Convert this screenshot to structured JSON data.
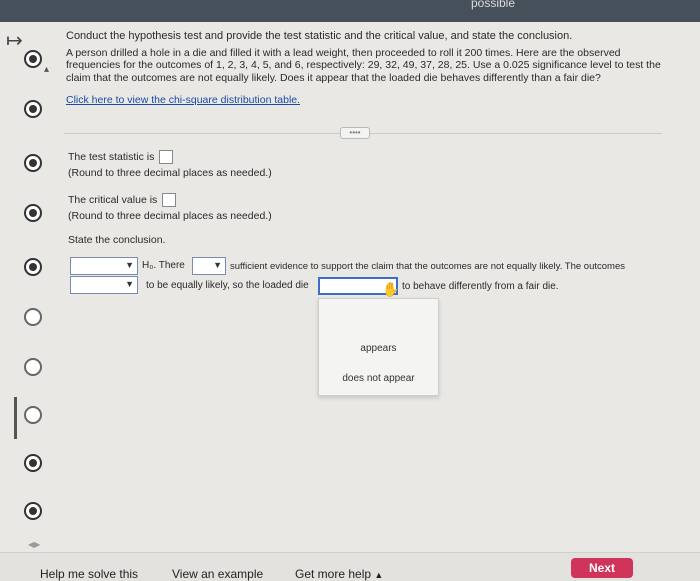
{
  "header": {
    "status_text": "possible"
  },
  "question": {
    "instruction": "Conduct the hypothesis test and provide the test statistic and the critical value, and state the conclusion.",
    "body": "A person drilled a hole in a die and filled it with a lead weight, then proceeded to roll it 200 times. Here are the observed frequencies for the outcomes of 1, 2, 3, 4, 5, and 6, respectively: 29, 32, 49, 37, 28, 25. Use a 0.025 significance level to test the claim that the outcomes are not equally likely. Does it appear that the loaded die behaves differently than a fair die?",
    "link_text": "Click here to view the chi-square distribution table."
  },
  "answers": {
    "test_stat_label": "The test statistic is",
    "test_stat_hint": "(Round to three decimal places as needed.)",
    "critical_label": "The critical value is",
    "critical_hint": "(Round to three decimal places as needed.)",
    "state_conclusion": "State the conclusion.",
    "conclusion": {
      "h0_text": "H₀. There",
      "middle_text": "sufficient evidence to support the claim that the outcomes are not equally likely. The outcomes",
      "line2_text": "to be equally likely, so the loaded die",
      "end_text": "to behave differently from a fair die."
    },
    "dropdown_options": [
      "appears",
      "does not appear"
    ]
  },
  "footer": {
    "help_solve": "Help me solve this",
    "view_example": "View an example",
    "get_more_help": "Get more help",
    "next": "Next"
  }
}
